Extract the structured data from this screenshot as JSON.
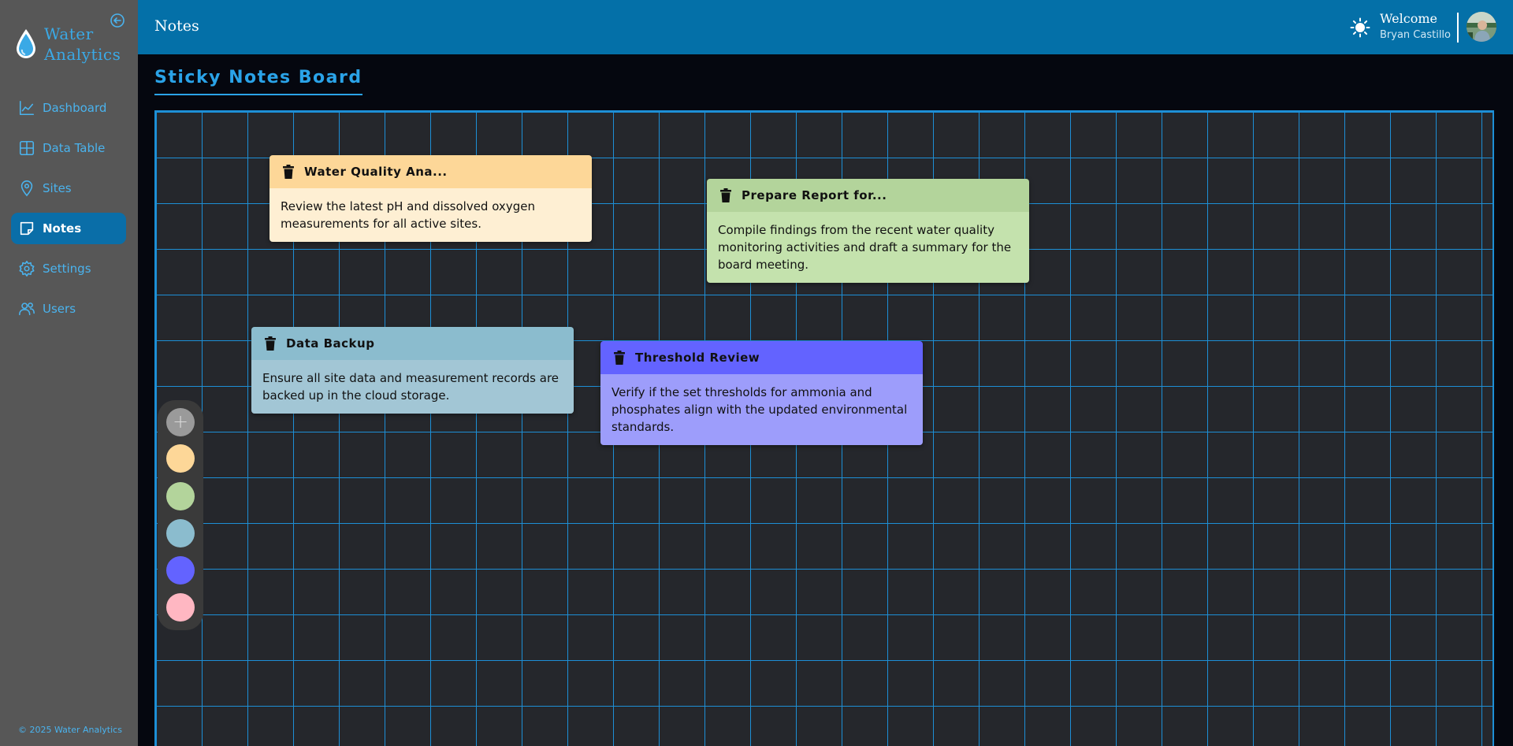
{
  "app": {
    "brand_line1": "Water",
    "brand_line2": "Analytics",
    "footer": "© 2025 Water Analytics"
  },
  "sidebar": {
    "items": [
      {
        "label": "Dashboard",
        "icon": "chart-line-icon"
      },
      {
        "label": "Data Table",
        "icon": "grid-icon"
      },
      {
        "label": "Sites",
        "icon": "map-pin-icon"
      },
      {
        "label": "Notes",
        "icon": "note-icon",
        "active": true
      },
      {
        "label": "Settings",
        "icon": "gear-icon"
      },
      {
        "label": "Users",
        "icon": "users-icon"
      }
    ]
  },
  "header": {
    "title": "Notes",
    "welcome": "Welcome",
    "user_name": "Bryan Castillo"
  },
  "board": {
    "title": "Sticky Notes Board",
    "palette": {
      "add_label": "+",
      "colors": [
        "#fdd798",
        "#b3d49b",
        "#8bbcce",
        "#6363ff",
        "#ffb7c2"
      ]
    },
    "notes": [
      {
        "title": "Water Quality Ana...",
        "body": "Review the latest pH and dissolved oxygen measurements for all active sites.",
        "header_color": "#fdd798",
        "body_color": "#feefd3"
      },
      {
        "title": "Prepare Report for...",
        "body": "Compile findings from the recent water quality monitoring activities and draft a summary for the board meeting.",
        "header_color": "#b3d49b",
        "body_color": "#c4e2ad"
      },
      {
        "title": "Data Backup",
        "body": "Ensure all site data and measurement records are backed up in the cloud storage.",
        "header_color": "#8bbcce",
        "body_color": "#a2c6d5"
      },
      {
        "title": "Threshold Review",
        "body": "Verify if the set thresholds for ammonia and phosphates align with the updated environmental standards.",
        "header_color": "#6363ff",
        "body_color": "#9d9dfb"
      }
    ]
  }
}
